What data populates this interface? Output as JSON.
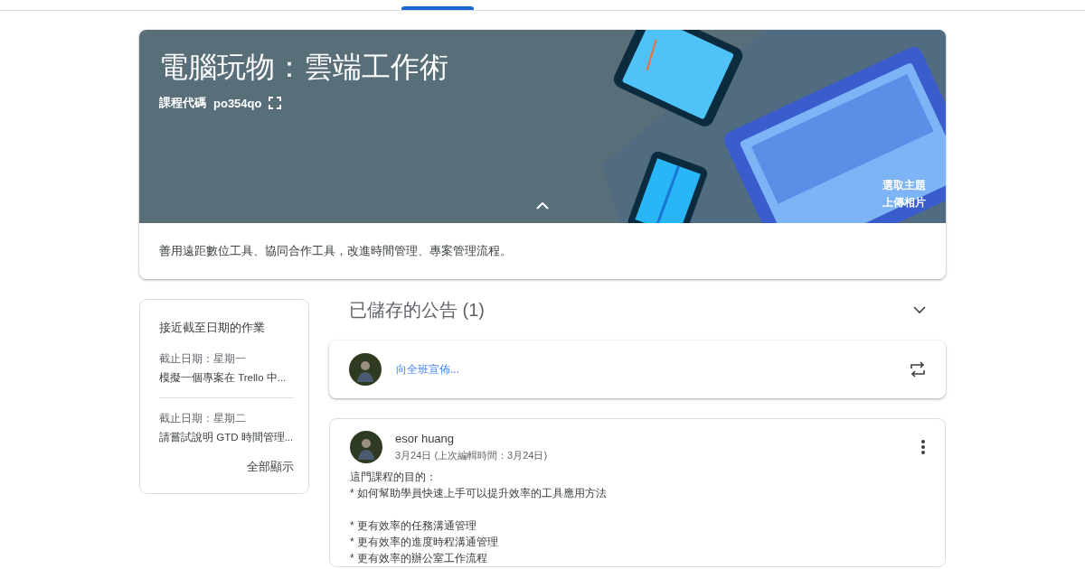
{
  "course": {
    "title": "電腦玩物：雲端工作術",
    "code_label": "課程代碼",
    "code": "po354qo",
    "theme_links": [
      "選取主題",
      "上傳相片"
    ],
    "description": "善用遠距數位工具、協同合作工具，改進時間管理、專案管理流程。"
  },
  "upcoming": {
    "title": "接近截至日期的作業",
    "items": [
      {
        "due": "截止日期：星期一",
        "name": "模擬一個專案在 Trello 中..."
      },
      {
        "due": "截止日期：星期二",
        "name": "請嘗試說明 GTD 時間管理..."
      }
    ],
    "view_all": "全部顯示"
  },
  "saved": {
    "title": "已儲存的公告 (1)",
    "expanded": false
  },
  "share": {
    "placeholder": "向全班宣佈..."
  },
  "post": {
    "author": "esor huang",
    "date": "3月24日 (上次編輯時間：3月24日)",
    "paragraphs": [
      [
        "這門課程的目的：",
        "* 如何幫助學員快速上手可以提升效率的工具應用方法"
      ],
      [
        "* 更有效率的任務溝通管理",
        "* 更有效率的進度時程溝通管理",
        "* 更有效率的辦公室工作流程"
      ]
    ]
  }
}
